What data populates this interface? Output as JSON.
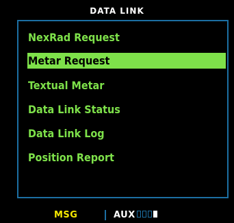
{
  "header": {
    "title": "DATA LINK"
  },
  "menu": {
    "items": [
      {
        "label": "NexRad Request",
        "selected": false
      },
      {
        "label": "Metar Request",
        "selected": true
      },
      {
        "label": "Textual Metar",
        "selected": false
      },
      {
        "label": "Data Link Status",
        "selected": false
      },
      {
        "label": "Data Link Log",
        "selected": false
      },
      {
        "label": "Position Report",
        "selected": false
      }
    ]
  },
  "status_bar": {
    "msg_label": "MSG",
    "aux_label": "AUX",
    "page_count": 4,
    "active_page": 4
  },
  "colors": {
    "menu_text": "#7ee14a",
    "selection_bg": "#7ee14a",
    "frame_border": "#1c6fa3",
    "msg_text": "#f5e800",
    "background": "#000000"
  }
}
